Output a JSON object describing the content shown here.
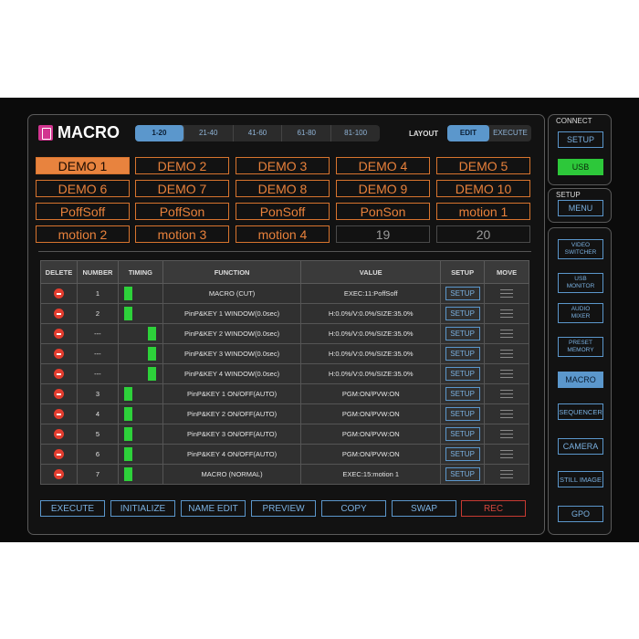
{
  "title": "MACRO",
  "pages": [
    "1-20",
    "21-40",
    "41-60",
    "61-80",
    "81-100"
  ],
  "active_page": 0,
  "layout": {
    "label": "LAYOUT",
    "edit": "EDIT",
    "execute": "EXECUTE"
  },
  "macros": [
    "DEMO 1",
    "DEMO 2",
    "DEMO 3",
    "DEMO 4",
    "DEMO 5",
    "DEMO 6",
    "DEMO 7",
    "DEMO 8",
    "DEMO 9",
    "DEMO 10",
    "PoffSoff",
    "PoffSon",
    "PonSoff",
    "PonSon",
    "motion 1",
    "motion 2",
    "motion 3",
    "motion 4",
    "19",
    "20"
  ],
  "table": {
    "headers": [
      "DELETE",
      "NUMBER",
      "TIMING",
      "FUNCTION",
      "VALUE",
      "SETUP",
      "MOVE"
    ],
    "rows": [
      {
        "number": "1",
        "timing": "start",
        "function": "MACRO (CUT)",
        "value": "EXEC:11:PoffSoff",
        "setup": "SETUP"
      },
      {
        "number": "2",
        "timing": "start",
        "function": "PinP&KEY 1 WINDOW(0.0sec)",
        "value": "H:0.0%/V:0.0%/SIZE:35.0%",
        "setup": "SETUP"
      },
      {
        "number": "---",
        "timing": "sub",
        "function": "PinP&KEY 2 WINDOW(0.0sec)",
        "value": "H:0.0%/V:0.0%/SIZE:35.0%",
        "setup": "SETUP"
      },
      {
        "number": "---",
        "timing": "sub",
        "function": "PinP&KEY 3 WINDOW(0.0sec)",
        "value": "H:0.0%/V:0.0%/SIZE:35.0%",
        "setup": "SETUP"
      },
      {
        "number": "---",
        "timing": "sub",
        "function": "PinP&KEY 4 WINDOW(0.0sec)",
        "value": "H:0.0%/V:0.0%/SIZE:35.0%",
        "setup": "SETUP"
      },
      {
        "number": "3",
        "timing": "start",
        "function": "PinP&KEY 1 ON/OFF(AUTO)",
        "value": "PGM:ON/PVW:ON",
        "setup": "SETUP"
      },
      {
        "number": "4",
        "timing": "start",
        "function": "PinP&KEY 2 ON/OFF(AUTO)",
        "value": "PGM:ON/PVW:ON",
        "setup": "SETUP"
      },
      {
        "number": "5",
        "timing": "start",
        "function": "PinP&KEY 3 ON/OFF(AUTO)",
        "value": "PGM:ON/PVW:ON",
        "setup": "SETUP"
      },
      {
        "number": "6",
        "timing": "start",
        "function": "PinP&KEY 4 ON/OFF(AUTO)",
        "value": "PGM:ON/PVW:ON",
        "setup": "SETUP"
      },
      {
        "number": "7",
        "timing": "start",
        "function": "MACRO (NORMAL)",
        "value": "EXEC:15:motion 1",
        "setup": "SETUP"
      }
    ]
  },
  "bottom_buttons": [
    "EXECUTE",
    "INITIALIZE",
    "NAME EDIT",
    "PREVIEW",
    "COPY",
    "SWAP",
    "REC"
  ],
  "side": {
    "connect_label": "CONNECT",
    "setup": "SETUP",
    "usb": "USB",
    "setup_label": "SETUP",
    "menu": "MENU",
    "nav": [
      "VIDEO\nSWITCHER",
      "USB\nMONITOR",
      "AUDIO\nMIXER",
      "PRESET\nMEMORY",
      "MACRO",
      "SEQUENCER",
      "CAMERA",
      "STILL IMAGE",
      "GPO"
    ]
  },
  "colors": {
    "accent": "#5b97cc",
    "orange": "#e8813b",
    "green": "#2dd13a",
    "red": "#e33d2f"
  }
}
